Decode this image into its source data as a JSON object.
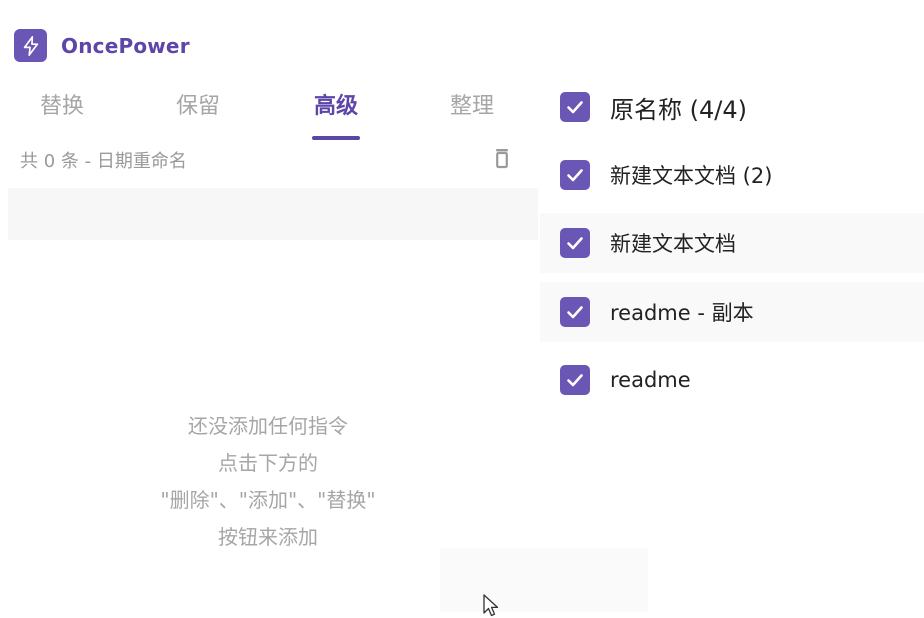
{
  "app": {
    "name": "OncePower",
    "logo_icon": "lightning-bolt-icon",
    "accent": "#6a56b5"
  },
  "tabs": [
    {
      "label": "替换",
      "active": false
    },
    {
      "label": "保留",
      "active": false
    },
    {
      "label": "高级",
      "active": true
    },
    {
      "label": "整理",
      "active": false
    }
  ],
  "rules": {
    "title": "共 0 条 - 日期重命名",
    "delete_icon": "trash-icon"
  },
  "empty_hint": {
    "line1": "还没添加任何指令",
    "line2": "点击下方的",
    "line3": "\"删除\"、\"添加\"、\"替换\"",
    "line4": "按钮来添加"
  },
  "files": {
    "header": {
      "label": "原名称 (4/4)",
      "checked": true
    },
    "items": [
      {
        "name": "新建文本文档 (2)",
        "checked": true
      },
      {
        "name": "新建文本文档",
        "checked": true
      },
      {
        "name": "readme - 副本",
        "checked": true
      },
      {
        "name": "readme",
        "checked": true
      }
    ]
  }
}
